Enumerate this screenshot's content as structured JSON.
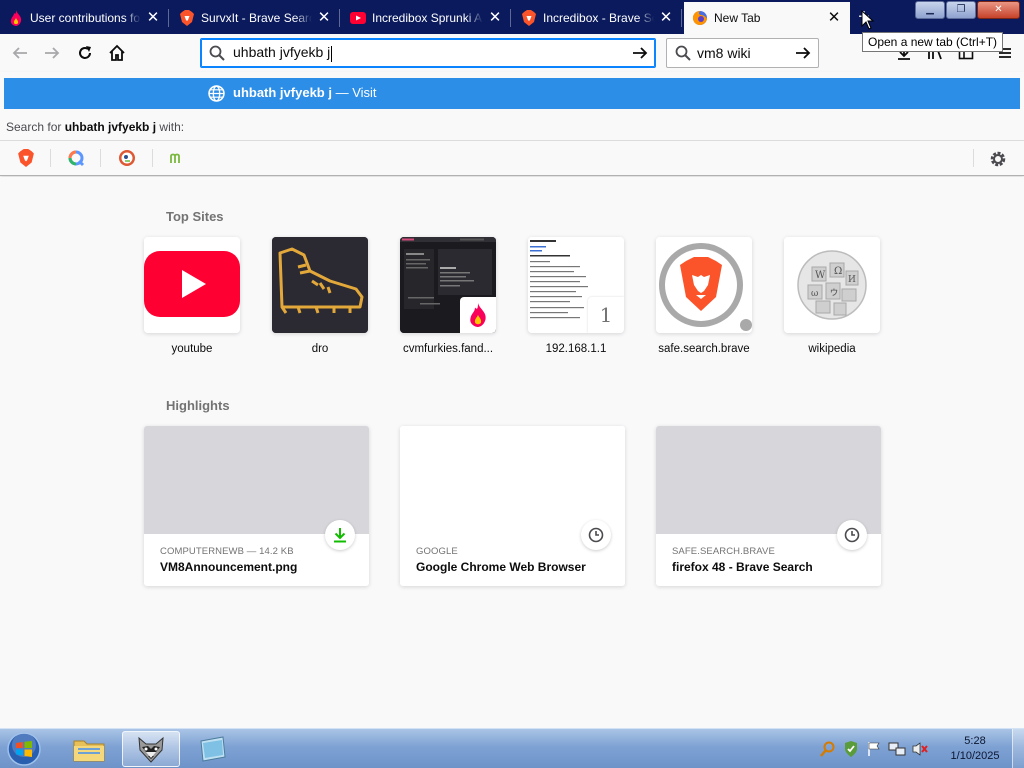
{
  "tabs": [
    {
      "title": "User contributions fo",
      "favicon": "fandom-flame-icon"
    },
    {
      "title": "SurvxIt - Brave Search",
      "favicon": "brave-lion-icon"
    },
    {
      "title": "Incredibox Sprunki A",
      "favicon": "youtube-icon"
    },
    {
      "title": "Incredibox - Brave Se",
      "favicon": "brave-lion-icon"
    },
    {
      "title": "New Tab",
      "favicon": "firefox-icon",
      "active": true
    }
  ],
  "new_tab_tooltip": "Open a new tab (Ctrl+T)",
  "urlbar": {
    "value": "uhbath jvfyekb j"
  },
  "searchbar": {
    "value": "vm8 wiki"
  },
  "dropdown": {
    "row_query": "uhbath jvfyekb j",
    "row_separator": "—",
    "row_action": "Visit",
    "search_with_prefix": "Search for",
    "search_with_query": "uhbath jvfyekb j",
    "search_with_suffix": "with:",
    "engines": [
      "brave-search-icon",
      "qwant-icon",
      "duckduckgo-icon",
      "mojeek-icon"
    ]
  },
  "top_sites": {
    "title": "Top Sites",
    "items": [
      {
        "label": "youtube",
        "icon": "youtube-logo-icon"
      },
      {
        "label": "dro",
        "icon": "boot-outline-icon"
      },
      {
        "label": "cvmfurkies.fand...",
        "icon": "screenshot-thumbnail-icon"
      },
      {
        "label": "192.168.1.1",
        "icon": "document-thumbnail-icon",
        "badge": "1"
      },
      {
        "label": "safe.search.brave",
        "icon": "brave-lion-logo-icon"
      },
      {
        "label": "wikipedia",
        "icon": "wikipedia-globe-icon"
      }
    ]
  },
  "highlights": {
    "title": "Highlights",
    "items": [
      {
        "meta": "COMPUTERNEWB — 14.2 KB",
        "title": "VM8Announcement.png",
        "badge": "download-icon"
      },
      {
        "meta": "GOOGLE",
        "title": "Google Chrome Web Browser",
        "badge": "clock-icon"
      },
      {
        "meta": "SAFE.SEARCH.BRAVE",
        "title": "firefox 48 - Brave Search",
        "badge": "clock-icon"
      }
    ]
  },
  "taskbar": {
    "clock_time": "5:28",
    "clock_date": "1/10/2025"
  },
  "colors": {
    "tabstrip": "#0a1a5c",
    "accent": "#0a84ff",
    "dropdown_highlight": "#2d8ee8",
    "youtube_red": "#ff0033",
    "brave_orange": "#fb542b"
  }
}
